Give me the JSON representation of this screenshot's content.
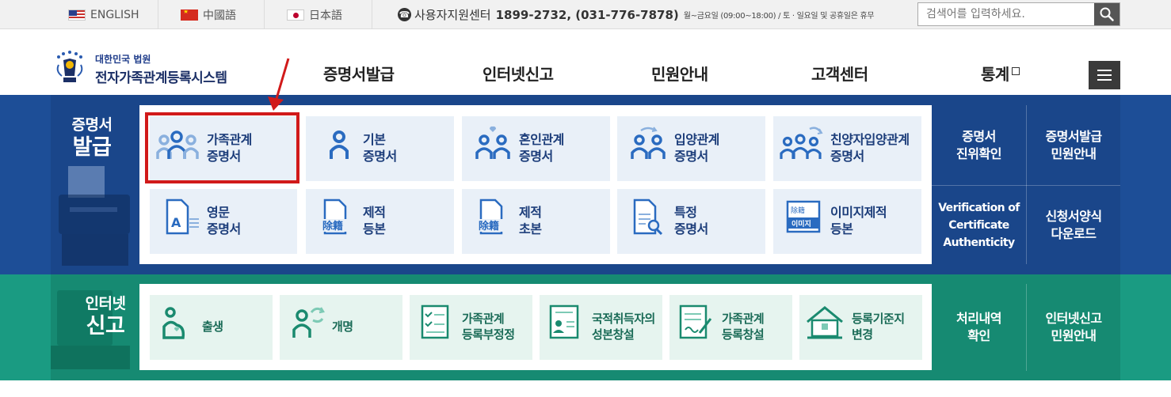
{
  "topbar": {
    "languages": [
      {
        "label": "ENGLISH",
        "flag": "us-flag-icon"
      },
      {
        "label": "中國語",
        "flag": "cn-flag-icon"
      },
      {
        "label": "日本語",
        "flag": "jp-flag-icon"
      }
    ],
    "support_label": "사용자지원센터",
    "support_phone": "1899-2732, (031-776-7878)",
    "support_hours": "월~금요일 (09:00~18:00) / 토 · 일요일 및 공휴일은 휴무",
    "search_placeholder": "검색어를 입력하세요."
  },
  "logo": {
    "line1": "대한민국 법원",
    "line2": "전자가족관계등록시스템"
  },
  "nav": [
    "증명서발급",
    "인터넷신고",
    "민원안내",
    "고객센터",
    "통계"
  ],
  "certificate": {
    "title_line1": "증명서",
    "title_line2": "발급",
    "cards": [
      {
        "line1": "가족관계",
        "line2": "증명서",
        "icon": "family-people-icon"
      },
      {
        "line1": "기본",
        "line2": "증명서",
        "icon": "person-icon"
      },
      {
        "line1": "혼인관계",
        "line2": "증명서",
        "icon": "couple-heart-icon"
      },
      {
        "line1": "입양관계",
        "line2": "증명서",
        "icon": "adoption-icon"
      },
      {
        "line1": "친양자입양관계",
        "line2": "증명서",
        "icon": "family-adoption-icon"
      },
      {
        "line1": "영문",
        "line2": "증명서",
        "icon": "english-document-icon"
      },
      {
        "line1": "제적",
        "line2": "등본",
        "icon": "removed-record-document-icon"
      },
      {
        "line1": "제적",
        "line2": "초본",
        "icon": "removed-record-extract-icon"
      },
      {
        "line1": "특정",
        "line2": "증명서",
        "icon": "document-search-icon"
      },
      {
        "line1": "이미지제적",
        "line2": "등본",
        "icon": "image-record-icon"
      }
    ],
    "stamp_text_1": "除籍",
    "stamp_text_2": "除籍",
    "image_stamp_top": "除籍",
    "image_stamp_label": "이미지",
    "side_links": [
      {
        "line1": "증명서",
        "line2": "진위확인"
      },
      {
        "line1": "증명서발급",
        "line2": "민원안내"
      },
      {
        "line1": "Verification of",
        "line2": "Certificate",
        "line3": "Authenticity"
      },
      {
        "line1": "신청서양식",
        "line2": "다운로드"
      }
    ]
  },
  "report": {
    "title_line1": "인터넷",
    "title_line2": "신고",
    "cards": [
      {
        "line1": "출생",
        "line2": "",
        "icon": "baby-birth-icon"
      },
      {
        "line1": "개명",
        "line2": "",
        "icon": "name-change-icon"
      },
      {
        "line1": "가족관계",
        "line2": "등록부정정",
        "icon": "checklist-icon"
      },
      {
        "line1": "국적취득자의",
        "line2": "성본창설",
        "icon": "id-card-icon"
      },
      {
        "line1": "가족관계",
        "line2": "등록창설",
        "icon": "document-write-icon"
      },
      {
        "line1": "등록기준지",
        "line2": "변경",
        "icon": "house-icon"
      }
    ],
    "side_links": [
      {
        "line1": "처리내역",
        "line2": "확인"
      },
      {
        "line1": "인터넷신고",
        "line2": "민원안내"
      }
    ]
  },
  "colors": {
    "blue_bg": "#1d4e97",
    "green_bg": "#1a9b82",
    "highlight": "#d11a1a"
  }
}
